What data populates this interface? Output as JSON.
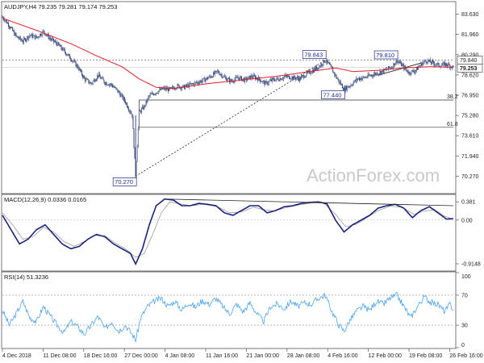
{
  "colors": {
    "candle": "#2c3e75",
    "ma": "#e0202a",
    "macd": "#1a237e",
    "signal": "#9a9a9a",
    "rsi": "#4aa3f0",
    "fib": "#333333",
    "trend": "#222222",
    "label_border": "#1a2a8a"
  },
  "watermark": "ActionForex.com",
  "chart_data": [
    {
      "type": "candlestick",
      "header": "AUDJPY,H4  79.235 79.281 79.174 79.253",
      "ylim": [
        68.9,
        84.6
      ],
      "y_ticks": [
        "83.630",
        "81.960",
        "80.290",
        "78.620",
        "76.950",
        "75.280",
        "73.610",
        "71.940",
        "70.270"
      ],
      "y_tick_values": [
        83.63,
        81.96,
        80.29,
        78.62,
        76.95,
        75.28,
        73.61,
        71.94,
        70.27
      ],
      "x_ticks": [
        "4 Dec 2018",
        "11 Dec 08:00",
        "18 Dec 16:00",
        "27 Dec 00:00",
        "4 Jan 08:00",
        "11 Jan 16:00",
        "21 Jan 00:00",
        "28 Jan 08:00",
        "4 Feb 16:00",
        "12 Feb 00:00",
        "19 Feb 08:00",
        "26 Feb 16:00"
      ],
      "price_key": [
        [
          0,
          83.4
        ],
        [
          8,
          82.7
        ],
        [
          16,
          81.8
        ],
        [
          24,
          81.4
        ],
        [
          32,
          81.9
        ],
        [
          40,
          81.7
        ],
        [
          48,
          82.2
        ],
        [
          56,
          81.6
        ],
        [
          64,
          81.2
        ],
        [
          72,
          80.6
        ],
        [
          80,
          80.0
        ],
        [
          88,
          79.3
        ],
        [
          96,
          78.3
        ],
        [
          104,
          77.9
        ],
        [
          112,
          78.6
        ],
        [
          120,
          78.0
        ],
        [
          128,
          77.8
        ],
        [
          136,
          77.2
        ],
        [
          144,
          76.4
        ],
        [
          152,
          75.3
        ],
        [
          156,
          70.3
        ],
        [
          160,
          75.5
        ],
        [
          166,
          76.0
        ],
        [
          172,
          76.9
        ],
        [
          180,
          77.2
        ],
        [
          188,
          77.5
        ],
        [
          196,
          77.4
        ],
        [
          204,
          77.7
        ],
        [
          212,
          77.6
        ],
        [
          220,
          77.8
        ],
        [
          228,
          78.0
        ],
        [
          236,
          78.2
        ],
        [
          244,
          78.5
        ],
        [
          252,
          78.9
        ],
        [
          260,
          78.4
        ],
        [
          268,
          78.1
        ],
        [
          276,
          78.4
        ],
        [
          284,
          78.2
        ],
        [
          292,
          78.5
        ],
        [
          300,
          78.3
        ],
        [
          308,
          77.9
        ],
        [
          316,
          78.2
        ],
        [
          324,
          78.3
        ],
        [
          332,
          78.5
        ],
        [
          340,
          78.4
        ],
        [
          348,
          78.3
        ],
        [
          356,
          78.7
        ],
        [
          364,
          79.0
        ],
        [
          372,
          79.4
        ],
        [
          378,
          79.84
        ],
        [
          384,
          79.3
        ],
        [
          392,
          78.3
        ],
        [
          400,
          77.44
        ],
        [
          408,
          77.8
        ],
        [
          416,
          78.3
        ],
        [
          424,
          78.4
        ],
        [
          432,
          78.6
        ],
        [
          440,
          78.8
        ],
        [
          448,
          79.0
        ],
        [
          456,
          79.3
        ],
        [
          462,
          79.81
        ],
        [
          468,
          79.4
        ],
        [
          476,
          78.8
        ],
        [
          484,
          79.0
        ],
        [
          490,
          79.5
        ],
        [
          496,
          79.8
        ],
        [
          504,
          79.6
        ],
        [
          512,
          79.4
        ],
        [
          520,
          79.5
        ],
        [
          528,
          79.25
        ]
      ],
      "ma_key": [
        [
          0,
          83.3
        ],
        [
          40,
          82.3
        ],
        [
          80,
          81.2
        ],
        [
          110,
          80.2
        ],
        [
          140,
          79.3
        ],
        [
          160,
          78.3
        ],
        [
          180,
          77.6
        ],
        [
          200,
          77.5
        ],
        [
          240,
          77.9
        ],
        [
          280,
          78.2
        ],
        [
          320,
          78.5
        ],
        [
          360,
          78.9
        ],
        [
          390,
          79.2
        ],
        [
          410,
          78.9
        ],
        [
          440,
          79.0
        ],
        [
          470,
          79.2
        ],
        [
          500,
          79.3
        ],
        [
          528,
          79.25
        ]
      ],
      "hlines": [
        {
          "value": 79.84,
          "style": "dotted"
        },
        {
          "value": 79.253,
          "style": "thin"
        }
      ],
      "fib_lines": [
        {
          "value": 76.55,
          "label": "38.2"
        },
        {
          "value": 74.3,
          "label": "61.8"
        }
      ],
      "trendline_from": [
        156,
        70.27
      ],
      "trendline_to": [
        378,
        79.84
      ],
      "swing_trend_from": [
        440,
        78.6
      ],
      "swing_trend_to": [
        490,
        79.6
      ],
      "annotations": [
        {
          "text": "79.843",
          "bar": 378,
          "value": 79.84
        },
        {
          "text": "79.810",
          "bar": 462,
          "value": 79.81
        },
        {
          "text": "77.440",
          "bar": 400,
          "value": 77.44
        },
        {
          "text": "70.270",
          "bar": 156,
          "value": 70.27
        }
      ],
      "last_price_tags": [
        "79.840",
        "79.253"
      ]
    },
    {
      "type": "line",
      "header": "MACD(12,26,9) 0.0336 0.0165",
      "ylim": [
        -1.05,
        0.52
      ],
      "y_ticks": [
        "0.381",
        "0.00",
        "-0.9148"
      ],
      "y_tick_values": [
        0.381,
        0.0,
        -0.9148
      ],
      "macd_key": [
        [
          0,
          0.1
        ],
        [
          10,
          -0.2
        ],
        [
          20,
          -0.5
        ],
        [
          30,
          -0.4
        ],
        [
          40,
          -0.2
        ],
        [
          50,
          -0.1
        ],
        [
          60,
          -0.3
        ],
        [
          70,
          -0.5
        ],
        [
          80,
          -0.6
        ],
        [
          90,
          -0.55
        ],
        [
          100,
          -0.4
        ],
        [
          110,
          -0.3
        ],
        [
          120,
          -0.35
        ],
        [
          130,
          -0.5
        ],
        [
          140,
          -0.6
        ],
        [
          150,
          -0.7
        ],
        [
          156,
          -0.92
        ],
        [
          164,
          -0.6
        ],
        [
          172,
          -0.1
        ],
        [
          180,
          0.3
        ],
        [
          190,
          0.44
        ],
        [
          200,
          0.42
        ],
        [
          210,
          0.3
        ],
        [
          220,
          0.3
        ],
        [
          230,
          0.35
        ],
        [
          240,
          0.33
        ],
        [
          250,
          0.3
        ],
        [
          260,
          0.15
        ],
        [
          270,
          0.1
        ],
        [
          280,
          0.2
        ],
        [
          290,
          0.3
        ],
        [
          300,
          0.3
        ],
        [
          310,
          0.15
        ],
        [
          320,
          0.2
        ],
        [
          330,
          0.28
        ],
        [
          340,
          0.3
        ],
        [
          350,
          0.35
        ],
        [
          360,
          0.37
        ],
        [
          370,
          0.38
        ],
        [
          380,
          0.34
        ],
        [
          390,
          0.0
        ],
        [
          400,
          -0.25
        ],
        [
          410,
          -0.1
        ],
        [
          420,
          0.0
        ],
        [
          430,
          0.1
        ],
        [
          440,
          0.25
        ],
        [
          450,
          0.3
        ],
        [
          460,
          0.33
        ],
        [
          470,
          0.25
        ],
        [
          480,
          0.05
        ],
        [
          490,
          0.2
        ],
        [
          500,
          0.28
        ],
        [
          510,
          0.15
        ],
        [
          520,
          0.02
        ],
        [
          528,
          0.03
        ]
      ],
      "signal_key": [
        [
          0,
          0.15
        ],
        [
          12,
          -0.1
        ],
        [
          24,
          -0.4
        ],
        [
          36,
          -0.35
        ],
        [
          48,
          -0.15
        ],
        [
          60,
          -0.25
        ],
        [
          72,
          -0.45
        ],
        [
          84,
          -0.55
        ],
        [
          96,
          -0.45
        ],
        [
          108,
          -0.32
        ],
        [
          120,
          -0.33
        ],
        [
          132,
          -0.48
        ],
        [
          144,
          -0.6
        ],
        [
          156,
          -0.78
        ],
        [
          166,
          -0.7
        ],
        [
          176,
          -0.3
        ],
        [
          186,
          0.15
        ],
        [
          196,
          0.38
        ],
        [
          208,
          0.34
        ],
        [
          220,
          0.3
        ],
        [
          236,
          0.33
        ],
        [
          252,
          0.28
        ],
        [
          266,
          0.15
        ],
        [
          280,
          0.17
        ],
        [
          294,
          0.27
        ],
        [
          306,
          0.22
        ],
        [
          318,
          0.19
        ],
        [
          332,
          0.26
        ],
        [
          348,
          0.32
        ],
        [
          362,
          0.36
        ],
        [
          376,
          0.36
        ],
        [
          390,
          0.12
        ],
        [
          402,
          -0.14
        ],
        [
          414,
          -0.09
        ],
        [
          426,
          0.04
        ],
        [
          440,
          0.2
        ],
        [
          454,
          0.29
        ],
        [
          468,
          0.27
        ],
        [
          482,
          0.12
        ],
        [
          494,
          0.19
        ],
        [
          506,
          0.22
        ],
        [
          518,
          0.08
        ],
        [
          528,
          0.02
        ]
      ],
      "trendline_from": [
        190,
        0.44
      ],
      "trendline_to": [
        528,
        0.3
      ]
    },
    {
      "type": "line",
      "header": "RSI(14) 51.3236",
      "ylim": [
        0,
        100
      ],
      "y_ticks": [
        "100",
        "70",
        "30",
        "0"
      ],
      "y_tick_values": [
        100,
        70,
        30,
        0
      ],
      "levels": [
        70,
        30
      ],
      "rsi_key": [
        [
          0,
          50
        ],
        [
          8,
          30
        ],
        [
          16,
          45
        ],
        [
          24,
          62
        ],
        [
          32,
          40
        ],
        [
          40,
          35
        ],
        [
          48,
          55
        ],
        [
          56,
          42
        ],
        [
          64,
          30
        ],
        [
          72,
          20
        ],
        [
          80,
          35
        ],
        [
          88,
          28
        ],
        [
          96,
          18
        ],
        [
          104,
          30
        ],
        [
          112,
          42
        ],
        [
          120,
          25
        ],
        [
          128,
          35
        ],
        [
          136,
          22
        ],
        [
          144,
          30
        ],
        [
          152,
          18
        ],
        [
          156,
          10
        ],
        [
          162,
          40
        ],
        [
          170,
          55
        ],
        [
          178,
          62
        ],
        [
          186,
          66
        ],
        [
          194,
          55
        ],
        [
          202,
          62
        ],
        [
          210,
          50
        ],
        [
          218,
          60
        ],
        [
          226,
          54
        ],
        [
          234,
          63
        ],
        [
          242,
          58
        ],
        [
          250,
          66
        ],
        [
          258,
          55
        ],
        [
          266,
          45
        ],
        [
          274,
          58
        ],
        [
          282,
          48
        ],
        [
          290,
          60
        ],
        [
          298,
          45
        ],
        [
          306,
          35
        ],
        [
          314,
          55
        ],
        [
          322,
          58
        ],
        [
          330,
          52
        ],
        [
          338,
          62
        ],
        [
          346,
          55
        ],
        [
          354,
          60
        ],
        [
          362,
          58
        ],
        [
          370,
          66
        ],
        [
          378,
          70
        ],
        [
          386,
          48
        ],
        [
          394,
          30
        ],
        [
          400,
          22
        ],
        [
          406,
          35
        ],
        [
          414,
          48
        ],
        [
          422,
          55
        ],
        [
          430,
          50
        ],
        [
          438,
          62
        ],
        [
          446,
          58
        ],
        [
          454,
          66
        ],
        [
          462,
          70
        ],
        [
          470,
          55
        ],
        [
          478,
          40
        ],
        [
          486,
          55
        ],
        [
          494,
          68
        ],
        [
          502,
          60
        ],
        [
          510,
          58
        ],
        [
          518,
          48
        ],
        [
          524,
          58
        ],
        [
          528,
          51
        ]
      ]
    }
  ]
}
